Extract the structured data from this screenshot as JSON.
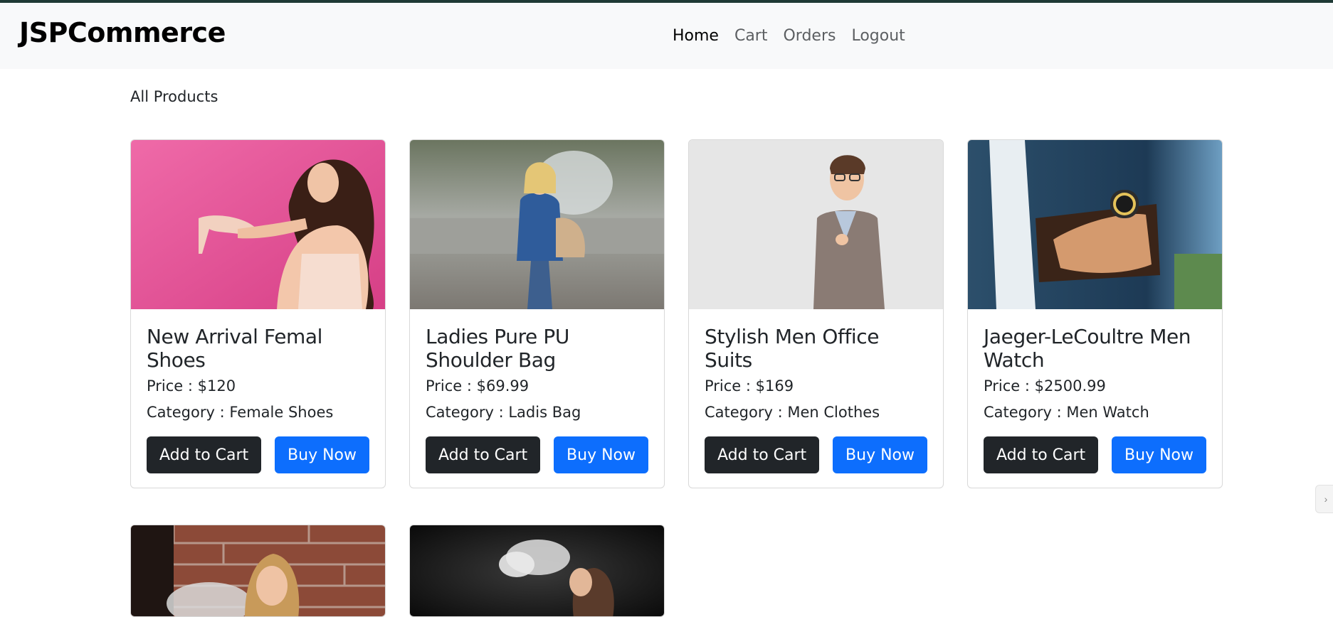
{
  "app": {
    "brand": "JSPCommerce"
  },
  "nav": {
    "items": [
      "Home",
      "Cart",
      "Orders",
      "Logout"
    ],
    "active": "Home"
  },
  "main": {
    "section_title": "All Products"
  },
  "labels": {
    "add_to_cart": "Add to Cart",
    "buy_now": "Buy Now"
  },
  "products": [
    {
      "title": "New Arrival Femal Shoes",
      "price": "Price : $120",
      "category": "Category : Female Shoes",
      "image": "woman-with-shoe"
    },
    {
      "title": "Ladies Pure PU Shoulder Bag",
      "price": "Price : $69.99",
      "category": "Category : Ladis Bag",
      "image": "woman-with-bag"
    },
    {
      "title": "Stylish Men Office Suits",
      "price": "Price : $169",
      "category": "Category : Men Clothes",
      "image": "man-in-suit"
    },
    {
      "title": "Jaeger-LeCoultre Men Watch",
      "price": "Price : $2500.99",
      "category": "Category : Men Watch",
      "image": "watch-on-wrist"
    }
  ],
  "colors": {
    "primary": "#0d6efd",
    "dark": "#212529",
    "navbar_bg": "#f8f9fa"
  }
}
